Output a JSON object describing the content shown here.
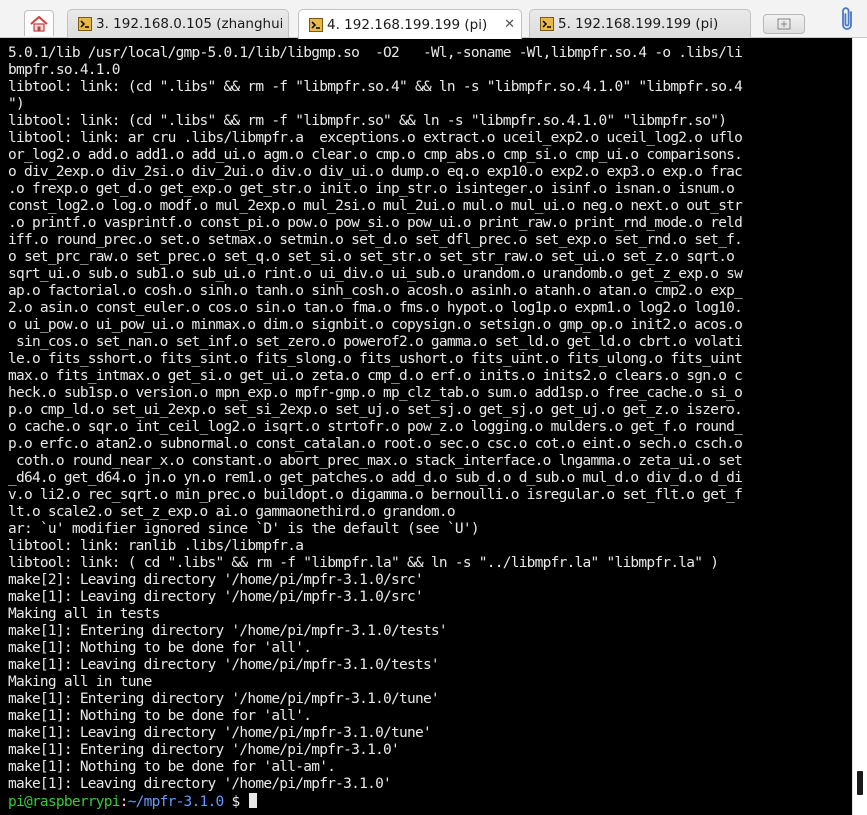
{
  "tabs": [
    {
      "label": "3. 192.168.0.105 (zhanghui)",
      "active": false
    },
    {
      "label": "4. 192.168.199.199 (pi)",
      "active": true
    },
    {
      "label": "5. 192.168.199.199 (pi)",
      "active": false
    }
  ],
  "icons": {
    "home": "home-icon",
    "terminal": "terminal-icon",
    "close": "close-icon",
    "new_tab": "new-tab-icon",
    "attach": "paperclip-icon"
  },
  "tab_close_glyph": "✕",
  "terminal": {
    "lines": [
      "5.0.1/lib /usr/local/gmp-5.0.1/lib/libgmp.so  -O2   -Wl,-soname -Wl,libmpfr.so.4 -o .libs/li",
      "bmpfr.so.4.1.0",
      "libtool: link: (cd \".libs\" && rm -f \"libmpfr.so.4\" && ln -s \"libmpfr.so.4.1.0\" \"libmpfr.so.4",
      "\")",
      "libtool: link: (cd \".libs\" && rm -f \"libmpfr.so\" && ln -s \"libmpfr.so.4.1.0\" \"libmpfr.so\")",
      "libtool: link: ar cru .libs/libmpfr.a  exceptions.o extract.o uceil_exp2.o uceil_log2.o uflo",
      "or_log2.o add.o add1.o add_ui.o agm.o clear.o cmp.o cmp_abs.o cmp_si.o cmp_ui.o comparisons.",
      "o div_2exp.o div_2si.o div_2ui.o div.o div_ui.o dump.o eq.o exp10.o exp2.o exp3.o exp.o frac",
      ".o frexp.o get_d.o get_exp.o get_str.o init.o inp_str.o isinteger.o isinf.o isnan.o isnum.o",
      "const_log2.o log.o modf.o mul_2exp.o mul_2si.o mul_2ui.o mul.o mul_ui.o neg.o next.o out_str",
      ".o printf.o vasprintf.o const_pi.o pow.o pow_si.o pow_ui.o print_raw.o print_rnd_mode.o reld",
      "iff.o round_prec.o set.o setmax.o setmin.o set_d.o set_dfl_prec.o set_exp.o set_rnd.o set_f.",
      "o set_prc_raw.o set_prec.o set_q.o set_si.o set_str.o set_str_raw.o set_ui.o set_z.o sqrt.o",
      "sqrt_ui.o sub.o sub1.o sub_ui.o rint.o ui_div.o ui_sub.o urandom.o urandomb.o get_z_exp.o sw",
      "ap.o factorial.o cosh.o sinh.o tanh.o sinh_cosh.o acosh.o asinh.o atanh.o atan.o cmp2.o exp_",
      "2.o asin.o const_euler.o cos.o sin.o tan.o fma.o fms.o hypot.o log1p.o expm1.o log2.o log10.",
      "o ui_pow.o ui_pow_ui.o minmax.o dim.o signbit.o copysign.o setsign.o gmp_op.o init2.o acos.o",
      " sin_cos.o set_nan.o set_inf.o set_zero.o powerof2.o gamma.o set_ld.o get_ld.o cbrt.o volati",
      "le.o fits_sshort.o fits_sint.o fits_slong.o fits_ushort.o fits_uint.o fits_ulong.o fits_uint",
      "max.o fits_intmax.o get_si.o get_ui.o zeta.o cmp_d.o erf.o inits.o inits2.o clears.o sgn.o c",
      "heck.o sub1sp.o version.o mpn_exp.o mpfr-gmp.o mp_clz_tab.o sum.o add1sp.o free_cache.o si_o",
      "p.o cmp_ld.o set_ui_2exp.o set_si_2exp.o set_uj.o set_sj.o get_sj.o get_uj.o get_z.o iszero.",
      "o cache.o sqr.o int_ceil_log2.o isqrt.o strtofr.o pow_z.o logging.o mulders.o get_f.o round_",
      "p.o erfc.o atan2.o subnormal.o const_catalan.o root.o sec.o csc.o cot.o eint.o sech.o csch.o",
      " coth.o round_near_x.o constant.o abort_prec_max.o stack_interface.o lngamma.o zeta_ui.o set",
      "_d64.o get_d64.o jn.o yn.o rem1.o get_patches.o add_d.o sub_d.o d_sub.o mul_d.o div_d.o d_di",
      "v.o li2.o rec_sqrt.o min_prec.o buildopt.o digamma.o bernoulli.o isregular.o set_flt.o get_f",
      "lt.o scale2.o set_z_exp.o ai.o gammaonethird.o grandom.o",
      "ar: `u' modifier ignored since `D' is the default (see `U')",
      "libtool: link: ranlib .libs/libmpfr.a",
      "libtool: link: ( cd \".libs\" && rm -f \"libmpfr.la\" && ln -s \"../libmpfr.la\" \"libmpfr.la\" )",
      "make[2]: Leaving directory '/home/pi/mpfr-3.1.0/src'",
      "make[1]: Leaving directory '/home/pi/mpfr-3.1.0/src'",
      "Making all in tests",
      "make[1]: Entering directory '/home/pi/mpfr-3.1.0/tests'",
      "make[1]: Nothing to be done for 'all'.",
      "make[1]: Leaving directory '/home/pi/mpfr-3.1.0/tests'",
      "Making all in tune",
      "make[1]: Entering directory '/home/pi/mpfr-3.1.0/tune'",
      "make[1]: Nothing to be done for 'all'.",
      "make[1]: Leaving directory '/home/pi/mpfr-3.1.0/tune'",
      "make[1]: Entering directory '/home/pi/mpfr-3.1.0'",
      "make[1]: Nothing to be done for 'all-am'.",
      "make[1]: Leaving directory '/home/pi/mpfr-3.1.0'"
    ],
    "prompt": {
      "user_host": "pi@raspberrypi",
      "separator": ":",
      "path": "~/mpfr-3.1.0",
      "symbol": " $ "
    }
  },
  "colors": {
    "terminal_bg": "#000000",
    "terminal_fg": "#e8e8e8",
    "prompt_user": "#33cc33",
    "prompt_path": "#6699ff",
    "tab_icon": "#e8b84a"
  }
}
